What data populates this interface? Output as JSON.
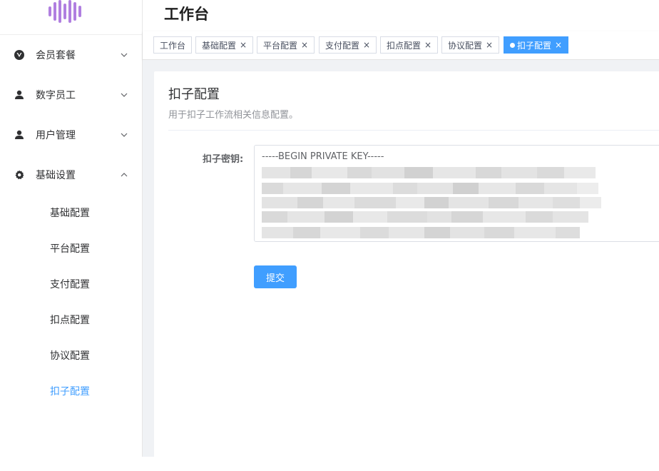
{
  "header": {
    "title": "工作台"
  },
  "sidebar": {
    "menu": [
      {
        "label": "会员套餐",
        "icon": "vuejs-icon",
        "expanded": false
      },
      {
        "label": "数字员工",
        "icon": "user-icon",
        "expanded": false
      },
      {
        "label": "用户管理",
        "icon": "user-icon",
        "expanded": false
      },
      {
        "label": "基础设置",
        "icon": "gear-icon",
        "expanded": true
      }
    ],
    "submenu": [
      {
        "label": "基础配置"
      },
      {
        "label": "平台配置"
      },
      {
        "label": "支付配置"
      },
      {
        "label": "扣点配置"
      },
      {
        "label": "协议配置"
      },
      {
        "label": "扣子配置",
        "active": true
      }
    ]
  },
  "tags": [
    {
      "label": "工作台",
      "closable": false
    },
    {
      "label": "基础配置",
      "closable": true
    },
    {
      "label": "平台配置",
      "closable": true
    },
    {
      "label": "支付配置",
      "closable": true
    },
    {
      "label": "扣点配置",
      "closable": true
    },
    {
      "label": "协议配置",
      "closable": true
    },
    {
      "label": "扣子配置",
      "closable": true,
      "active": true
    }
  ],
  "tag_close_glyph": "×",
  "card": {
    "title": "扣子配置",
    "description": "用于扣子工作流相关信息配置。",
    "key_label": "扣子密钥:",
    "key_value_header": "-----BEGIN PRIVATE KEY-----",
    "submit_label": "提交"
  },
  "colors": {
    "accent": "#409eff",
    "logo": "#b07fe0"
  }
}
